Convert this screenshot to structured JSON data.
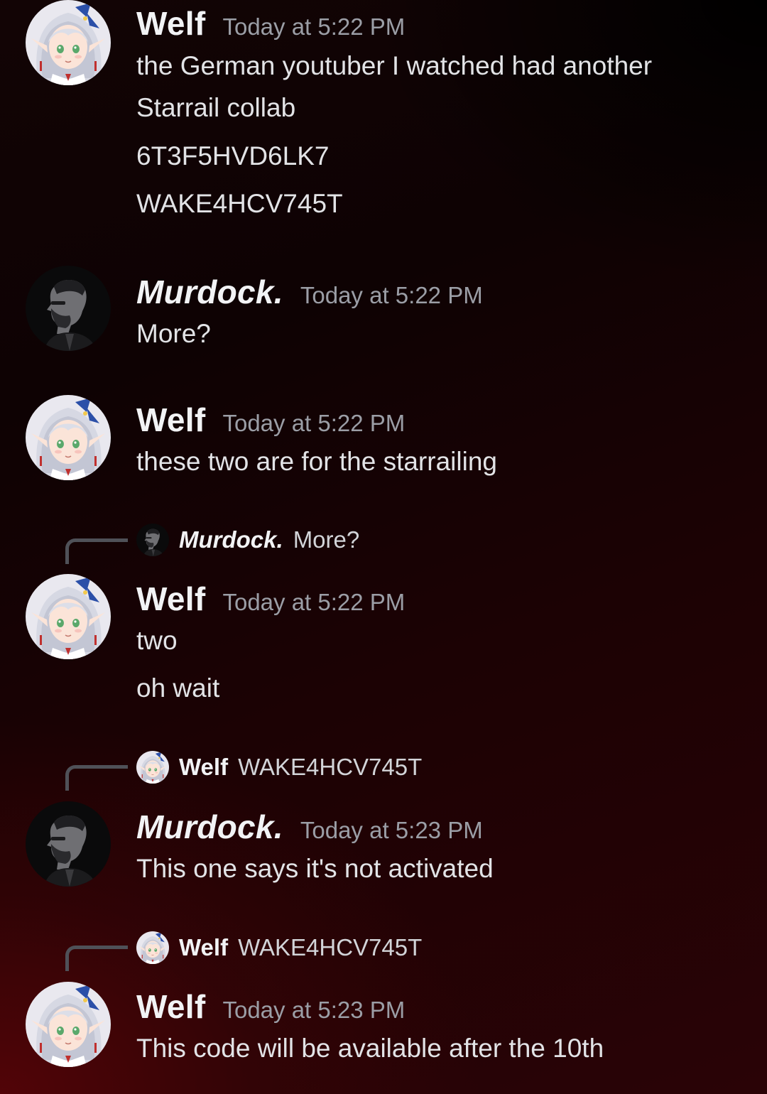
{
  "users": {
    "welf": {
      "name": "Welf",
      "avatar_icon": "welf-avatar-icon"
    },
    "murdock": {
      "name": "Murdock.",
      "avatar_icon": "murdock-avatar-icon"
    }
  },
  "messages": [
    {
      "author": "Welf",
      "time": "Today at 5:22 PM",
      "lines": [
        "the German youtuber I watched had another",
        "Starrail collab",
        "6T3F5HVD6LK7",
        "WAKE4HCV745T"
      ]
    },
    {
      "author": "Murdock.",
      "time": "Today at 5:22 PM",
      "lines": [
        "More?"
      ]
    },
    {
      "author": "Welf",
      "time": "Today at 5:22 PM",
      "lines": [
        "these two are for the starrailing"
      ]
    },
    {
      "reply_to": {
        "author": "Murdock.",
        "text": "More?"
      },
      "author": "Welf",
      "time": "Today at 5:22 PM",
      "lines": [
        "two",
        "oh wait"
      ]
    },
    {
      "reply_to": {
        "author": "Welf",
        "text": "WAKE4HCV745T"
      },
      "author": "Murdock.",
      "time": "Today at 5:23 PM",
      "lines": [
        "This one says it's not activated"
      ]
    },
    {
      "reply_to": {
        "author": "Welf",
        "text": "WAKE4HCV745T"
      },
      "author": "Welf",
      "time": "Today at 5:23 PM",
      "lines": [
        "This code will be available after the 10th"
      ]
    }
  ]
}
